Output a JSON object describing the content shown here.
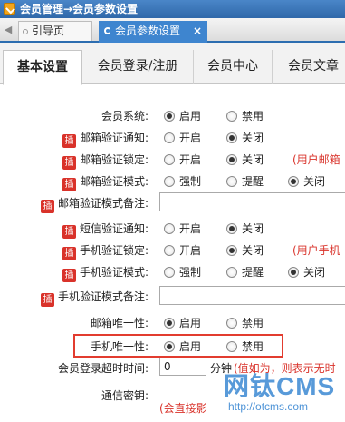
{
  "window": {
    "title": "会员管理→会员参数设置",
    "title_icon": "folder-arrow-icon"
  },
  "tabs": {
    "back_glyph": "◀",
    "items": [
      {
        "label": "引导页",
        "icon": "circle-icon"
      },
      {
        "label": "会员参数设置",
        "icon": "refresh-icon",
        "close": "×"
      }
    ]
  },
  "subtabs": [
    "基本设置",
    "会员登录/注册",
    "会员中心",
    "会员文章"
  ],
  "badge_text": "插",
  "options": {
    "enable": "启用",
    "disable": "禁用",
    "open": "开启",
    "close": "关闭",
    "force": "强制",
    "remind": "提醒"
  },
  "rows": {
    "member_system": {
      "label": "会员系统:"
    },
    "email_notify": {
      "label": "邮箱验证通知:"
    },
    "email_lock": {
      "label": "邮箱验证锁定:",
      "note": "(用户邮箱"
    },
    "email_mode": {
      "label": "邮箱验证模式:"
    },
    "email_mode_note": {
      "label": "邮箱验证模式备注:"
    },
    "sms_notify": {
      "label": "短信验证通知:"
    },
    "phone_lock": {
      "label": "手机验证锁定:",
      "note": "(用户手机"
    },
    "phone_mode": {
      "label": "手机验证模式:"
    },
    "phone_mode_note": {
      "label": "手机验证模式备注:"
    },
    "email_unique": {
      "label": "邮箱唯一性:"
    },
    "phone_unique": {
      "label": "手机唯一性:"
    },
    "login_timeout": {
      "label": "会员登录超时时间:",
      "value": "0",
      "unit": "分钟",
      "hint": "(值如为，则表示无时"
    },
    "comm_key": {
      "label": "通信密钥:",
      "hint": "(会直接影"
    }
  },
  "watermark": {
    "brand": "网钛CMS",
    "url": "http://otcms.com"
  }
}
